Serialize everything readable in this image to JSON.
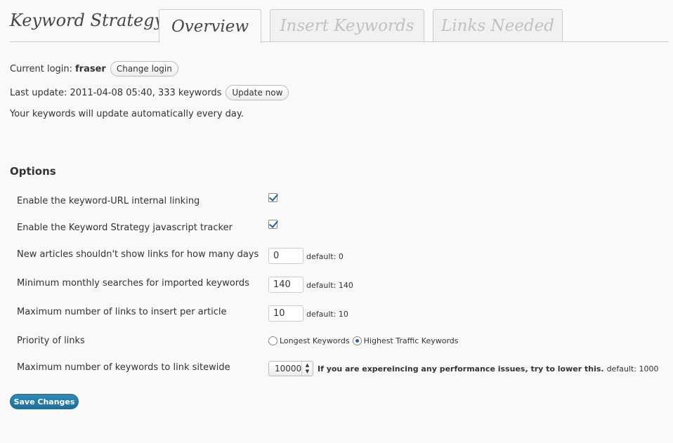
{
  "header": {
    "title": "Keyword Strategy",
    "tabs": [
      {
        "label": "Overview",
        "active": true
      },
      {
        "label": "Insert Keywords",
        "active": false
      },
      {
        "label": "Links Needed",
        "active": false
      }
    ]
  },
  "status": {
    "login_label": "Current login:",
    "login_user": "fraser",
    "change_login_label": "Change login",
    "last_update_text": "Last update: 2011-04-08 05:40, 333 keywords",
    "update_now_label": "Update now",
    "auto_update_text": "Your keywords will update automatically every day."
  },
  "options": {
    "heading": "Options",
    "internal_linking_label": "Enable the keyword-URL internal linking",
    "internal_linking_checked": true,
    "tracker_label": "Enable the Keyword Strategy javascript tracker",
    "tracker_checked": true,
    "new_articles_label": "New articles shouldn't show links for how many days",
    "new_articles_value": "0",
    "new_articles_default": "default: 0",
    "min_searches_label": "Minimum monthly searches for imported keywords",
    "min_searches_value": "140",
    "min_searches_default": "default: 140",
    "max_links_label": "Maximum number of links to insert per article",
    "max_links_value": "10",
    "max_links_default": "default: 10",
    "priority_label": "Priority of links",
    "priority_options": [
      {
        "label": "Longest Keywords",
        "checked": false
      },
      {
        "label": "Highest Traffic Keywords",
        "checked": true
      }
    ],
    "max_sitewide_label": "Maximum number of keywords to link sitewide",
    "max_sitewide_value": "10000",
    "max_sitewide_note": "If you are expereincing any performance issues, try to lower this.",
    "max_sitewide_default": "default: 1000"
  },
  "save_label": "Save Changes"
}
